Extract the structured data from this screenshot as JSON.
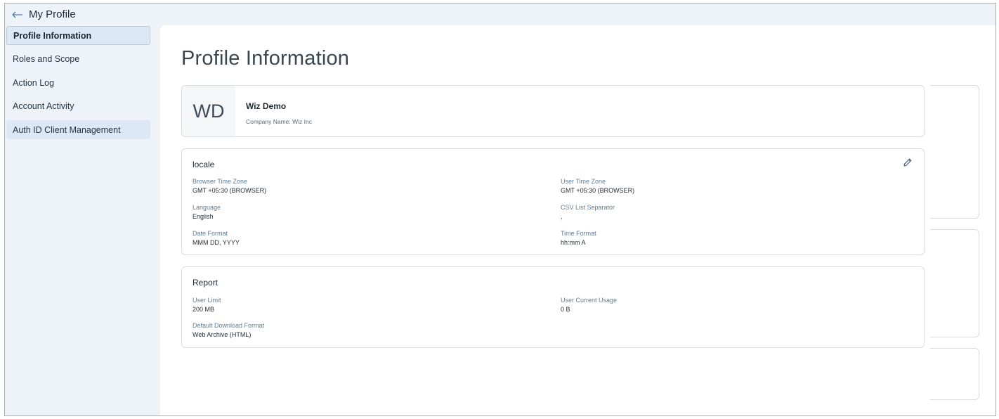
{
  "header": {
    "title": "My Profile"
  },
  "sidebar": {
    "items": [
      {
        "label": "Profile Information"
      },
      {
        "label": "Roles and Scope"
      },
      {
        "label": "Action Log"
      },
      {
        "label": "Account Activity"
      },
      {
        "label": "Auth ID Client Management"
      }
    ]
  },
  "main": {
    "title": "Profile Information",
    "profile": {
      "initials": "WD",
      "name": "Wiz Demo",
      "company": "Company Name: Wiz Inc"
    },
    "locale": {
      "title": "locale",
      "fields": [
        {
          "label": "Browser Time Zone",
          "value": "GMT +05:30 (BROWSER)"
        },
        {
          "label": "User Time Zone",
          "value": "GMT +05:30 (BROWSER)"
        },
        {
          "label": "Language",
          "value": "English"
        },
        {
          "label": "CSV List Separator",
          "value": ","
        },
        {
          "label": "Date Format",
          "value": "MMM DD, YYYY"
        },
        {
          "label": "Time Format",
          "value": "hh:mm A"
        }
      ]
    },
    "report": {
      "title": "Report",
      "fields": [
        {
          "label": "User Limit",
          "value": "200 MB"
        },
        {
          "label": "User Current Usage",
          "value": "0 B"
        },
        {
          "label": "Default Download Format",
          "value": "Web Archive (HTML)"
        }
      ]
    }
  },
  "colors": {
    "accent": "#5f7d96",
    "active_bg": "#dce8f6",
    "frame_bg": "#eef3fa"
  }
}
